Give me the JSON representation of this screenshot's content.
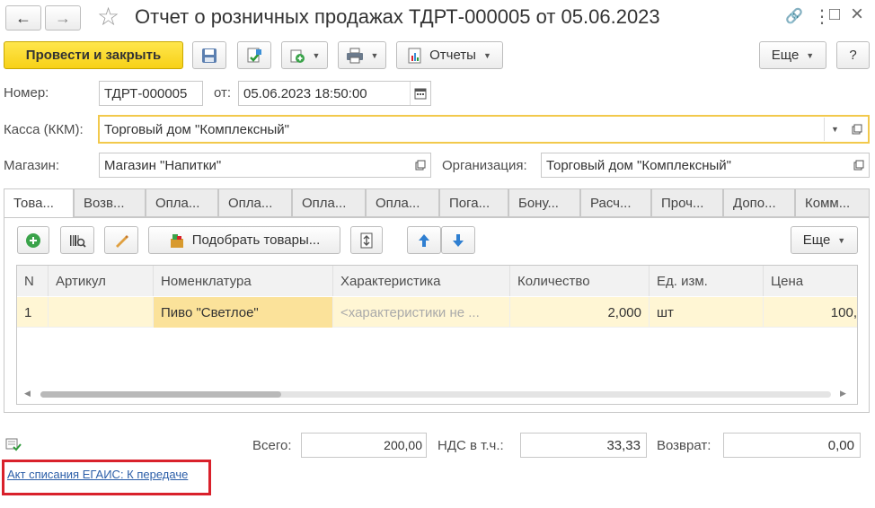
{
  "window": {
    "title": "Отчет о розничных продажах ТДРТ-000005 от 05.06.2023"
  },
  "nav": {
    "back": "←",
    "forward": "→",
    "star": "☆",
    "link": "🔗",
    "menu": "⋮",
    "maximize": "□",
    "close": "×"
  },
  "toolbar": {
    "post_close": "Провести и закрыть",
    "reports": "Отчеты",
    "more": "Еще",
    "help": "?"
  },
  "header": {
    "number_label": "Номер:",
    "number_value": "ТДРТ-000005",
    "date_label": "от:",
    "date_value": "05.06.2023 18:50:00",
    "kassa_label": "Касса (ККМ):",
    "kassa_value": "Торговый дом \"Комплексный\"",
    "store_label": "Магазин:",
    "store_value": "Магазин \"Напитки\"",
    "org_label": "Организация:",
    "org_value": "Торговый дом \"Комплексный\""
  },
  "tabs": [
    {
      "label": "Това..."
    },
    {
      "label": "Возв..."
    },
    {
      "label": "Опла..."
    },
    {
      "label": "Опла..."
    },
    {
      "label": "Опла..."
    },
    {
      "label": "Опла..."
    },
    {
      "label": "Пога..."
    },
    {
      "label": "Бону..."
    },
    {
      "label": "Расч..."
    },
    {
      "label": "Проч..."
    },
    {
      "label": "Допо..."
    },
    {
      "label": "Комм..."
    }
  ],
  "table_toolbar": {
    "pick_goods": "Подобрать товары...",
    "more": "Еще"
  },
  "table": {
    "columns": [
      "N",
      "Артикул",
      "Номенклатура",
      "Характеристика",
      "Количество",
      "Ед. изм.",
      "Цена"
    ],
    "rows": [
      {
        "n": "1",
        "article": "",
        "nomenclature": "Пиво \"Светлое\"",
        "characteristic": "<характеристики не ...",
        "qty": "2,000",
        "unit": "шт",
        "price": "100,"
      }
    ]
  },
  "totals": {
    "total_label": "Всего:",
    "total_value": "200,00",
    "vat_label": "НДС в т.ч.:",
    "vat_value": "33,33",
    "return_label": "Возврат:",
    "return_value": "0,00"
  },
  "footer": {
    "egais_link": "Акт списания ЕГАИС: К передаче"
  },
  "colors": {
    "accent_yellow": "#f7d117",
    "highlight_box": "#d9212b",
    "link": "#2b5ea8",
    "selected_row": "#fff6d4"
  }
}
